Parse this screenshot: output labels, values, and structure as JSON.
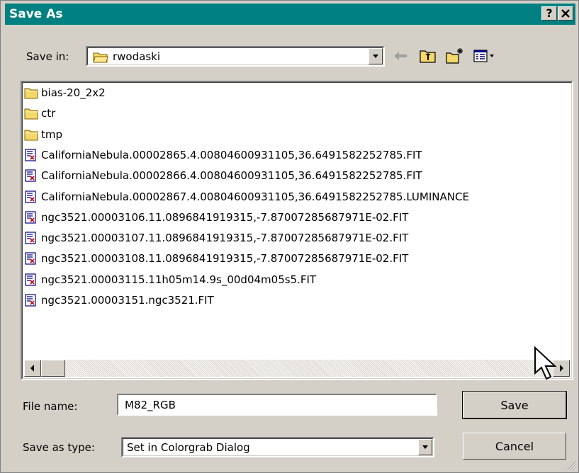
{
  "window": {
    "title": "Save As",
    "help_button": "?",
    "close_button": "✕"
  },
  "save_in": {
    "label": "Save in:",
    "folder": "rwodaski"
  },
  "toolbar": {
    "back_icon": "back-arrow-icon",
    "up_icon": "up-one-level-icon",
    "new_folder_icon": "new-folder-icon",
    "view_icon": "view-menu-icon"
  },
  "files": [
    {
      "name": "bias-20_2x2",
      "type": "folder"
    },
    {
      "name": "ctr",
      "type": "folder"
    },
    {
      "name": "tmp",
      "type": "folder"
    },
    {
      "name": "CaliforniaNebula.00002865.4.00804600931105,36.6491582252785.FIT",
      "type": "file"
    },
    {
      "name": "CaliforniaNebula.00002866.4.00804600931105,36.6491582252785.FIT",
      "type": "file"
    },
    {
      "name": "CaliforniaNebula.00002867.4.00804600931105,36.6491582252785.LUMINANCE",
      "type": "file"
    },
    {
      "name": "ngc3521.00003106.11.0896841919315,-7.87007285687971E-02.FIT",
      "type": "file"
    },
    {
      "name": "ngc3521.00003107.11.0896841919315,-7.87007285687971E-02.FIT",
      "type": "file"
    },
    {
      "name": "ngc3521.00003108.11.0896841919315,-7.87007285687971E-02.FIT",
      "type": "file"
    },
    {
      "name": "ngc3521.00003115.11h05m14.9s_00d04m05s5.FIT",
      "type": "file"
    },
    {
      "name": "ngc3521.00003151.ngc3521.FIT",
      "type": "file"
    }
  ],
  "file_name": {
    "label": "File name:",
    "value": "M82_RGB"
  },
  "save_as_type": {
    "label": "Save as type:",
    "value": "Set in Colorgrab Dialog"
  },
  "buttons": {
    "save": "Save",
    "cancel": "Cancel"
  },
  "colors": {
    "titlebar": "#008080",
    "face": "#d4d0c8",
    "folder": "#f4d86a"
  }
}
